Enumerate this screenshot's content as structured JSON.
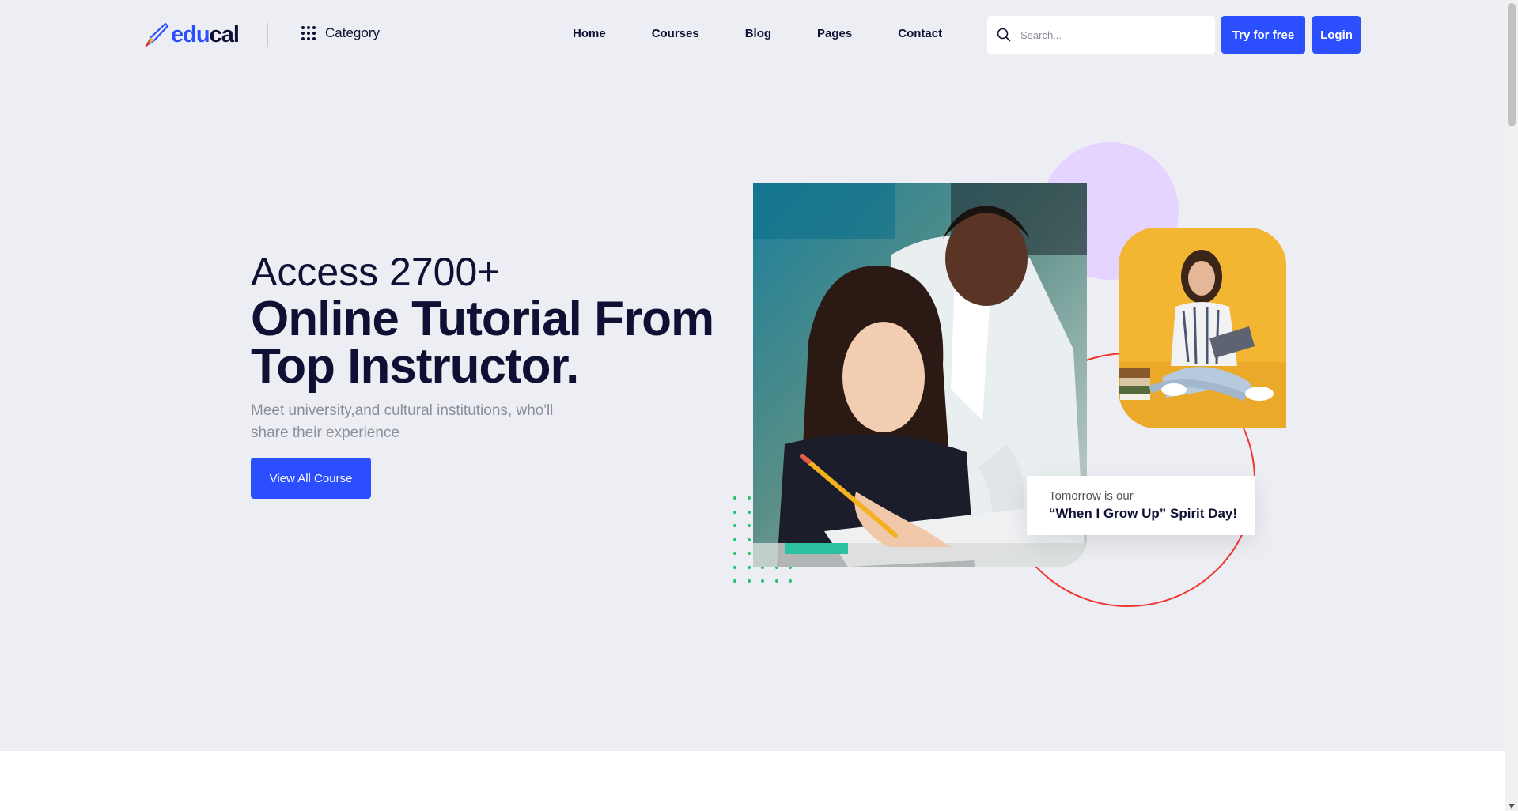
{
  "header": {
    "logo_part1": "edu",
    "logo_part2": "cal",
    "category_label": "Category",
    "nav": [
      "Home",
      "Courses",
      "Blog",
      "Pages",
      "Contact"
    ],
    "search_placeholder": "Search...",
    "try_label": "Try for free",
    "login_label": "Login"
  },
  "hero": {
    "subtitle": "Access 2700+",
    "title_line1": "Online Tutorial From",
    "title_line2": "Top Instructor.",
    "description": "Meet university,and cultural institutions, who'll share their experience",
    "cta_label": "View All Course"
  },
  "note": {
    "small": "Tomorrow is our",
    "big": "“When I Grow Up” Spirit Day!"
  },
  "colors": {
    "brand": "#2b4eff",
    "dark": "#0e1133",
    "background": "#edeef3",
    "ring": "#f0362d",
    "lavender": "#e5d4ff",
    "dots": "#24c36b",
    "side_bg": "#f2b632"
  }
}
